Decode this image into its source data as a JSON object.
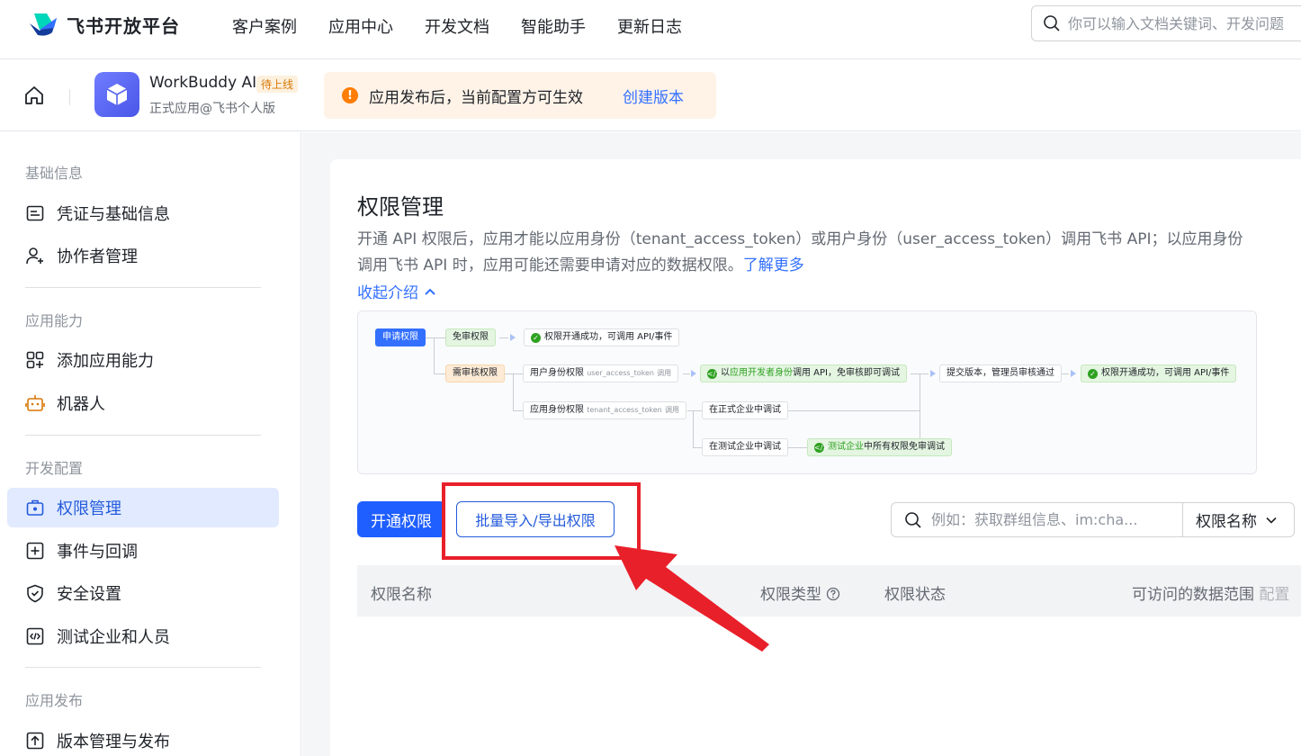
{
  "nav": {
    "logo_text": "飞书开放平台",
    "items": [
      "客户案例",
      "应用中心",
      "开发文档",
      "智能助手",
      "更新日志"
    ],
    "search_placeholder": "你可以输入文档关键词、开发问题"
  },
  "app": {
    "name": "WorkBuddy AI",
    "badge": "待上线",
    "subtitle": "正式应用@飞书个人版"
  },
  "notice": {
    "text": "应用发布后，当前配置方可生效",
    "link": "创建版本"
  },
  "sidebar": {
    "sections": [
      {
        "title": "基础信息",
        "items": [
          {
            "label": "凭证与基础信息",
            "icon": "credential-icon"
          },
          {
            "label": "协作者管理",
            "icon": "user-add-icon"
          }
        ]
      },
      {
        "title": "应用能力",
        "items": [
          {
            "label": "添加应用能力",
            "icon": "apps-add-icon"
          },
          {
            "label": "机器人",
            "icon": "robot-icon"
          }
        ]
      },
      {
        "title": "开发配置",
        "items": [
          {
            "label": "权限管理",
            "icon": "permission-icon",
            "active": true
          },
          {
            "label": "事件与回调",
            "icon": "event-icon"
          },
          {
            "label": "安全设置",
            "icon": "shield-icon"
          },
          {
            "label": "测试企业和人员",
            "icon": "code-icon"
          }
        ]
      },
      {
        "title": "应用发布",
        "items": [
          {
            "label": "版本管理与发布",
            "icon": "upload-icon"
          }
        ]
      }
    ]
  },
  "main": {
    "title": "权限管理",
    "desc": "开通 API 权限后，应用才能以应用身份（tenant_access_token）或用户身份（user_access_token）调用飞书 API；以应用身份调用飞书 API 时，应用可能还需要申请对应的数据权限。",
    "learn_more": "了解更多",
    "collapse": "收起介绍",
    "flow": {
      "apply": "申请权限",
      "free": "免审权限",
      "free_result": "权限开通成功，可调用 API/事件",
      "review": "需审核权限",
      "user_perm": "用户身份权限",
      "user_token": "user_access_token",
      "call": "调用",
      "user_result_pre": "以",
      "user_result_hl": "应用开发者身份",
      "user_result_post": "调用 API，免审核即可调试",
      "submit": "提交版本，管理员审核通过",
      "final_result": "权限开通成功，可调用 API/事件",
      "app_perm": "应用身份权限",
      "app_token": "tenant_access_token",
      "prod_debug": "在正式企业中调试",
      "test_debug": "在测试企业中调试",
      "test_result_hl": "测试企业",
      "test_result_post": "中所有权限免审调试"
    },
    "btn_open": "开通权限",
    "btn_batch": "批量导入/导出权限",
    "search_placeholder": "例如：获取群组信息、im:cha...",
    "select_value": "权限名称",
    "table_headers": {
      "name": "权限名称",
      "type": "权限类型",
      "status": "权限状态",
      "scope": "可访问的数据范围",
      "config": "配置"
    }
  },
  "colors": {
    "accent": "#3370ff",
    "annotation": "#e8202a",
    "warning": "#ff7d00"
  }
}
